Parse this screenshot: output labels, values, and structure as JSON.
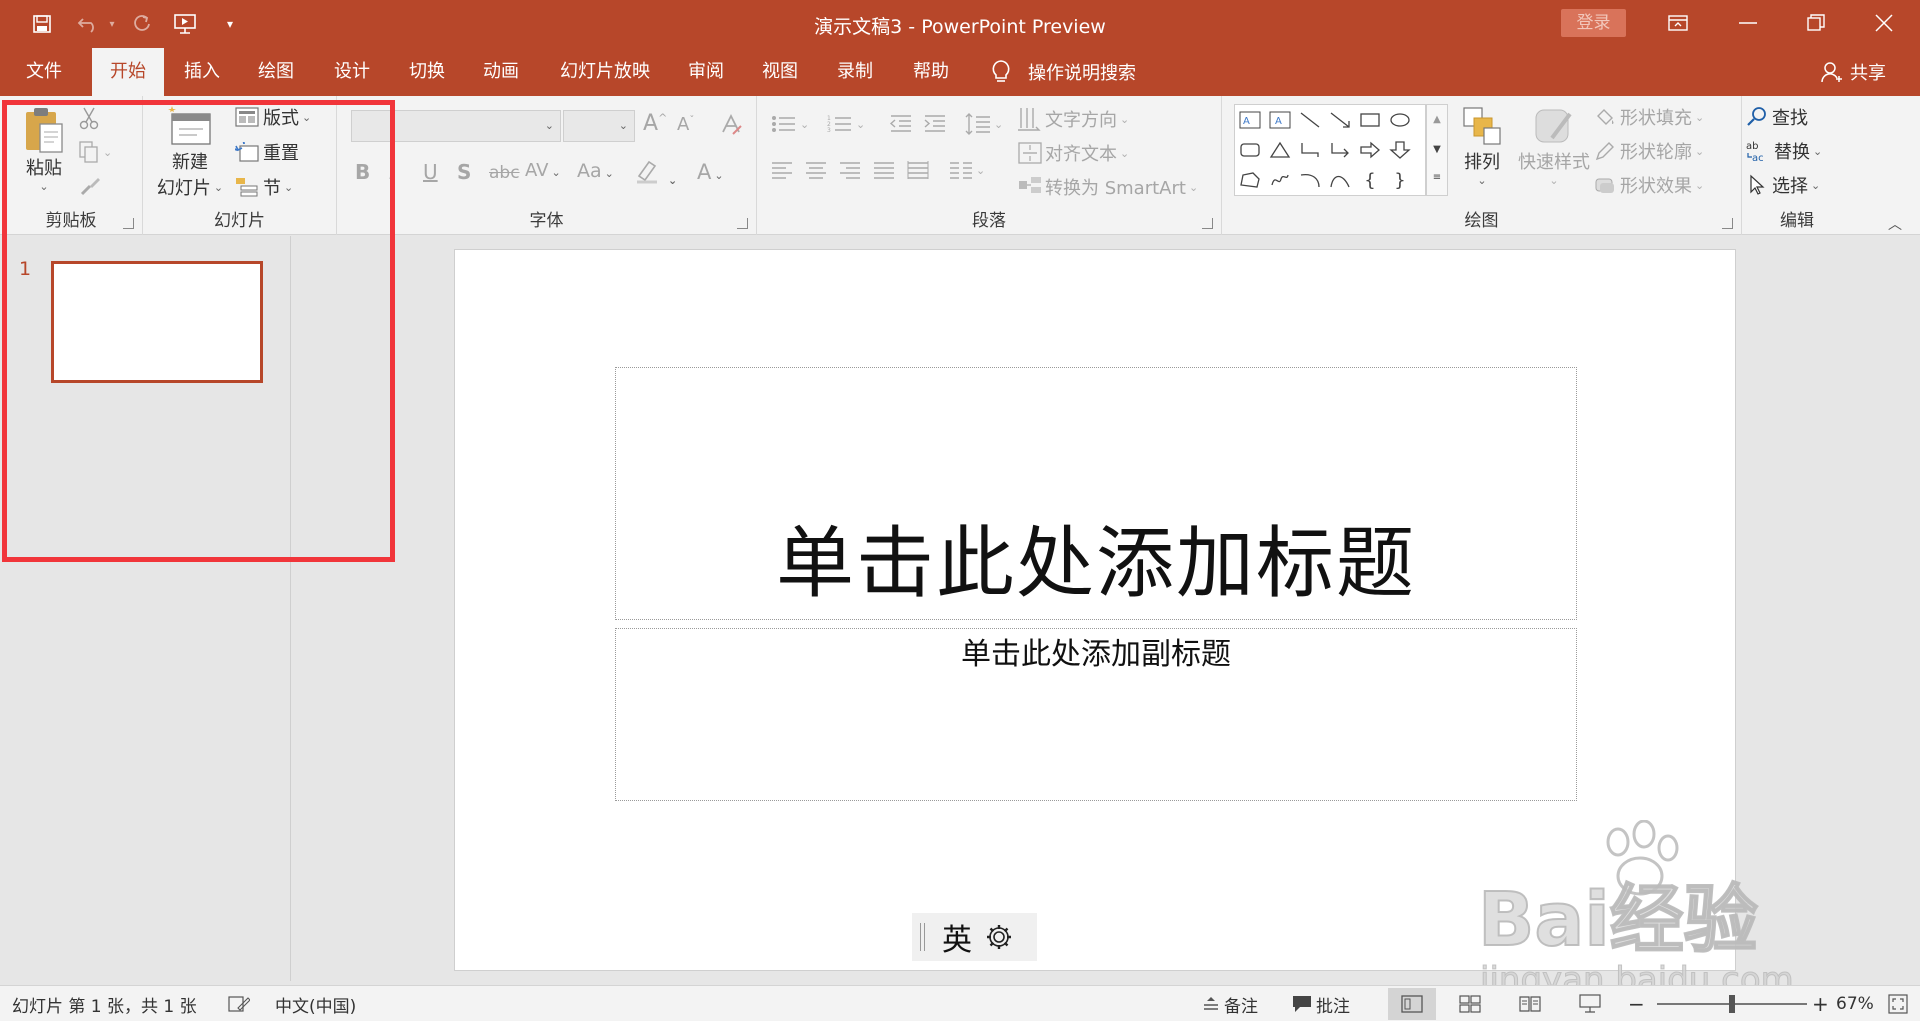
{
  "window": {
    "title": "演示文稿3  -  PowerPoint Preview",
    "login_label": "登录",
    "accent": "#b7472a"
  },
  "tabs": [
    {
      "label": "文件",
      "active": false
    },
    {
      "label": "开始",
      "active": true
    },
    {
      "label": "插入",
      "active": false
    },
    {
      "label": "绘图",
      "active": false
    },
    {
      "label": "设计",
      "active": false
    },
    {
      "label": "切换",
      "active": false
    },
    {
      "label": "动画",
      "active": false
    },
    {
      "label": "幻灯片放映",
      "active": false
    },
    {
      "label": "审阅",
      "active": false
    },
    {
      "label": "视图",
      "active": false
    },
    {
      "label": "录制",
      "active": false
    },
    {
      "label": "帮助",
      "active": false
    }
  ],
  "help_search": {
    "label": "操作说明搜索",
    "icon": "lightbulb-icon"
  },
  "share": {
    "label": "共享",
    "icon": "person-icon"
  },
  "ribbon": {
    "clipboard": {
      "label": "剪贴板",
      "paste": "粘贴"
    },
    "slides": {
      "label": "幻灯片",
      "new_slide_line1": "新建",
      "new_slide_line2": "幻灯片",
      "layout": "版式",
      "reset": "重置",
      "section": "节"
    },
    "font": {
      "label": "字体",
      "bold": "B",
      "italic": "I",
      "underline": "U",
      "strike": "S",
      "abc": "abc",
      "av": "AV",
      "aa": "Aa",
      "a": "A"
    },
    "paragraph": {
      "label": "段落",
      "text_direction": "文字方向",
      "align_text": "对齐文本",
      "smartart": "转换为 SmartArt"
    },
    "drawing": {
      "label": "绘图",
      "arrange": "排列",
      "quick_styles": "快速样式",
      "shape_fill": "形状填充",
      "shape_outline": "形状轮廓",
      "shape_effects": "形状效果"
    },
    "editing": {
      "label": "编辑",
      "find": "查找",
      "replace": "替换",
      "select": "选择"
    }
  },
  "thumbnails": {
    "slide_number": "1"
  },
  "slide": {
    "title_placeholder": "单击此处添加标题",
    "subtitle_placeholder": "单击此处添加副标题"
  },
  "ime": {
    "mode": "英"
  },
  "watermark": {
    "logo": "Bai经验",
    "url": "jingyan.baidu.com"
  },
  "statusbar": {
    "slide_info": "幻灯片 第 1 张，共 1 张",
    "language": "中文(中国)",
    "notes": "备注",
    "comments": "批注",
    "zoom_minus": "−",
    "zoom_plus": "+",
    "zoom_level": "67%",
    "zoom_fraction": 0.5
  }
}
